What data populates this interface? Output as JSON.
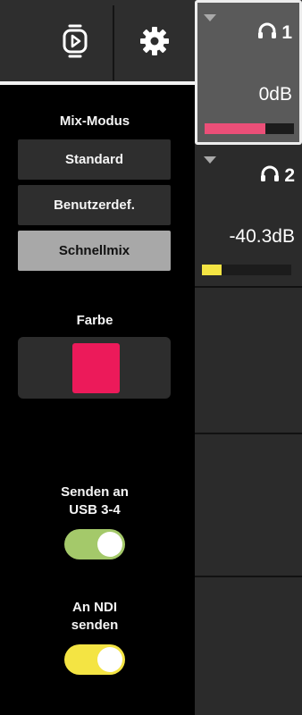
{
  "header": {
    "playout_icon": "playout-icon",
    "settings_icon": "gear-icon"
  },
  "mix_mode": {
    "label": "Mix-Modus",
    "options": [
      {
        "label": "Standard",
        "active": false
      },
      {
        "label": "Benutzerdef.",
        "active": false
      },
      {
        "label": "Schnellmix",
        "active": true
      }
    ]
  },
  "color": {
    "label": "Farbe",
    "value": "#ec1a5a"
  },
  "send_usb": {
    "label": "Senden an\nUSB 3-4",
    "on": true,
    "color": "#a4c96a"
  },
  "send_ndi": {
    "label": "An NDI\nsenden",
    "on": true,
    "color": "#f4e443"
  },
  "mixes": [
    {
      "number": "1",
      "icon": "headphones-icon",
      "level": "0dB",
      "meter_fraction": 0.68,
      "meter_color": "#ec4f78",
      "selected": true
    },
    {
      "number": "2",
      "icon": "headphones-icon",
      "level": "-40.3dB",
      "meter_fraction": 0.22,
      "meter_color": "#f4e443",
      "selected": false
    }
  ]
}
